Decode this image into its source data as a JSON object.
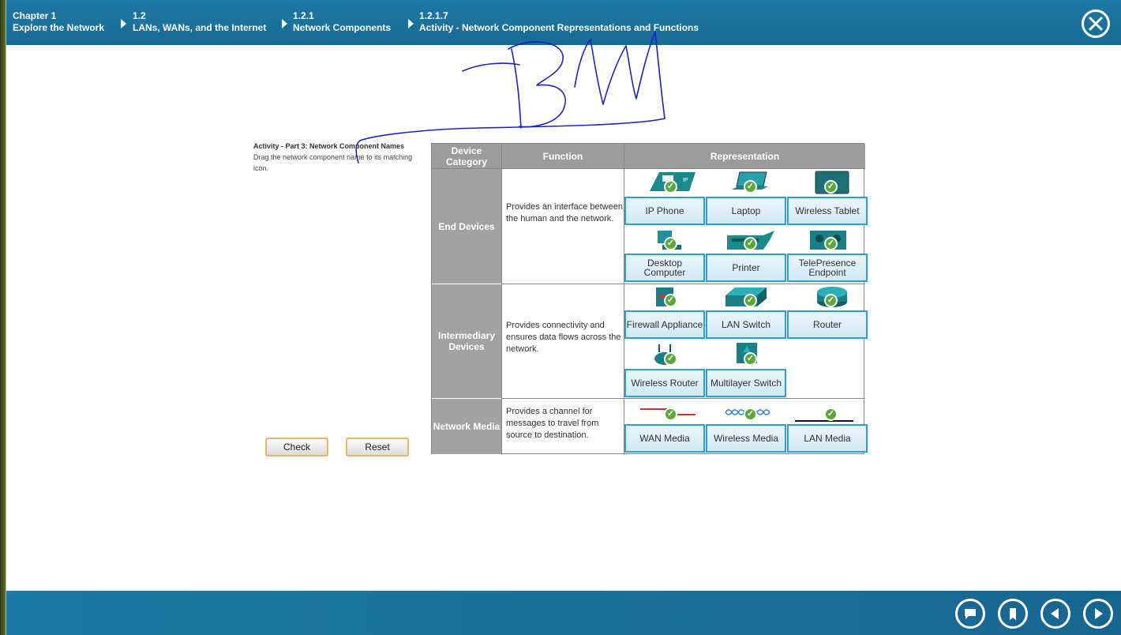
{
  "breadcrumb": [
    {
      "num": "Chapter 1",
      "text": "Explore the Network"
    },
    {
      "num": "1.2",
      "text": "LANs, WANs, and the Internet"
    },
    {
      "num": "1.2.1",
      "text": "Network Components"
    },
    {
      "num": "1.2.1.7",
      "text": "Activity - Network Component Representations and Functions"
    }
  ],
  "instructions": {
    "title": "Activity - Part 3: Network Component Names",
    "body": "Drag the network component name to its matching icon."
  },
  "buttons": {
    "check": "Check",
    "reset": "Reset"
  },
  "table": {
    "headers": {
      "category": "Device Category",
      "function": "Function",
      "representation": "Representation"
    },
    "rows": [
      {
        "category": "End Devices",
        "function": "Provides an interface between the human and the network.",
        "names": [
          "IP Phone",
          "Laptop",
          "Wireless Tablet",
          "Desktop Computer",
          "Printer",
          "TelePresence Endpoint"
        ]
      },
      {
        "category": "Intermediary Devices",
        "function": "Provides connectivity and ensures data flows across the network.",
        "names": [
          "Firewall Appliance",
          "LAN Switch",
          "Router",
          "Wireless Router",
          "Multilayer Switch"
        ]
      },
      {
        "category": "Network Media",
        "function": "Provides a channel for messages to travel from source to destination.",
        "names": [
          "WAN Media",
          "Wireless Media",
          "LAN Media"
        ]
      }
    ]
  },
  "icons": {
    "close": "close-icon",
    "nav": [
      "comment-icon",
      "bookmark-icon",
      "previous-icon",
      "next-icon"
    ]
  },
  "colors": {
    "bar": "#1d7aa4",
    "accent_border": "#2d9fd9",
    "check": "#5aa83a",
    "annotation": "#1a22cc"
  }
}
